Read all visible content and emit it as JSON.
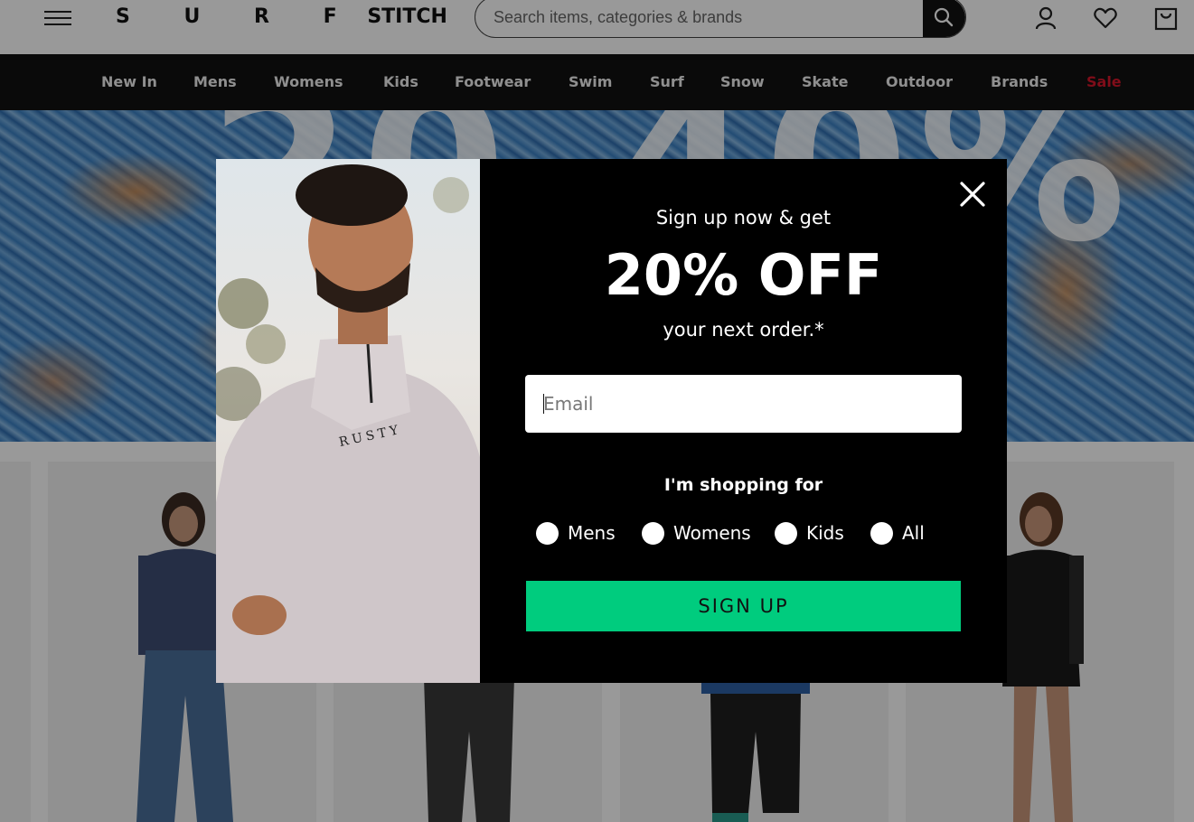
{
  "header": {
    "logo_part1": "S U R F",
    "logo_part2": "STITCH",
    "search_placeholder": "Search items, categories & brands"
  },
  "nav": {
    "items": [
      "New In",
      "Mens",
      "Womens",
      "Kids",
      "Footwear",
      "Swim",
      "Surf",
      "Snow",
      "Skate",
      "Outdoor",
      "Brands",
      "Sale"
    ]
  },
  "hero": {
    "headline": "20-40%"
  },
  "popup": {
    "line1": "Sign up now & get",
    "offer": "20% OFF",
    "line2": "your next order.*",
    "email_placeholder": "Email",
    "shopping_for_label": "I'm shopping for",
    "options": [
      "Mens",
      "Womens",
      "Kids",
      "All"
    ],
    "signup_label": "SIGN UP",
    "photo_brand_text": "RUSTY"
  },
  "colors": {
    "nav_bg": "#111111",
    "sale": "#d6162b",
    "signup_button": "#00cc7e",
    "modal_bg": "#000000"
  }
}
